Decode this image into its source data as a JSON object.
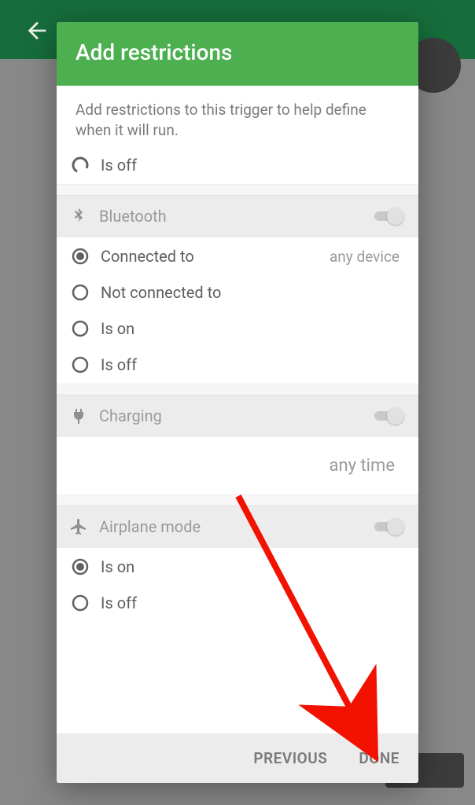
{
  "dialog": {
    "title": "Add restrictions",
    "intro": "Add restrictions to this trigger to help define when it will run.",
    "partial_option": {
      "label": "Is off"
    },
    "sections": [
      {
        "icon": "bluetooth",
        "title": "Bluetooth",
        "switch_on": false,
        "options": [
          {
            "label": "Connected to",
            "checked": true,
            "note": "any device"
          },
          {
            "label": "Not connected to",
            "checked": false
          },
          {
            "label": "Is on",
            "checked": false
          },
          {
            "label": "Is off",
            "checked": false
          }
        ]
      },
      {
        "icon": "charging",
        "title": "Charging",
        "switch_on": false,
        "note": "any time"
      },
      {
        "icon": "airplane",
        "title": "Airplane mode",
        "switch_on": false,
        "options": [
          {
            "label": "Is on",
            "checked": true
          },
          {
            "label": "Is off",
            "checked": false
          }
        ]
      }
    ],
    "actions": {
      "previous": "PREVIOUS",
      "done": "DONE"
    }
  }
}
